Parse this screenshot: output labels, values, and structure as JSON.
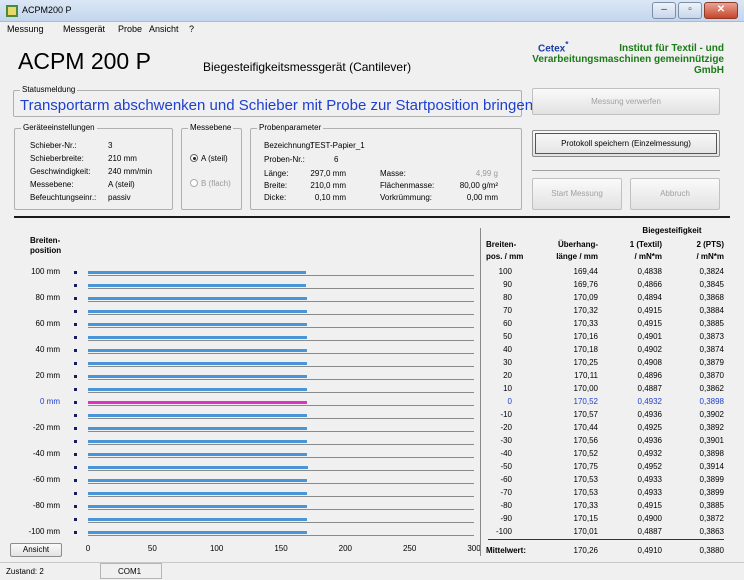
{
  "window": {
    "title": "ACPM200 P",
    "buttons": [
      "–",
      "▫",
      "✕"
    ]
  },
  "menu": [
    "Messung",
    "Messgerät",
    "Probe",
    "Ansicht",
    "?"
  ],
  "header": {
    "title": "ACPM 200 P",
    "subtitle": "Biegesteifigkeitsmessgerät  (Cantilever)",
    "brand": "Cetex",
    "brand_mark": "*",
    "institute": [
      "Institut für Textil - und",
      "Verarbeitungsmaschinen gemeinnützige",
      "GmbH"
    ]
  },
  "status": {
    "label": "Statusmeldung",
    "message": "Transportarm abschwenken und Schieber mit Probe zur Startposition bringen!"
  },
  "device": {
    "label": "Geräteeinstellungen",
    "rows": [
      {
        "k": "Schieber-Nr.:",
        "v": "3"
      },
      {
        "k": "Schieberbreite:",
        "v": "210 mm"
      },
      {
        "k": "Geschwindigkeit:",
        "v": "240 mm/min"
      },
      {
        "k": "Messebene:",
        "v": "A (steil)"
      },
      {
        "k": "Befeuchtungseinr.:",
        "v": "passiv"
      }
    ]
  },
  "plane": {
    "label": "Messebene",
    "a": "A (steil)",
    "b": "B (flach)"
  },
  "sample": {
    "label": "Probenparameter",
    "name_key": "Bezeichnung:",
    "name_val": "TEST-Papier_1",
    "nr_key": "Proben-Nr.:",
    "nr_val": "6",
    "left": [
      {
        "k": "Länge:",
        "v": "297,0 mm"
      },
      {
        "k": "Breite:",
        "v": "210,0 mm"
      },
      {
        "k": "Dicke:",
        "v": "0,10 mm"
      }
    ],
    "right": [
      {
        "k": "Masse:",
        "v": "4,99 g",
        "grey": true
      },
      {
        "k": "Flächenmasse:",
        "v": "80,00 g/m²",
        "grey": false
      },
      {
        "k": "Vorkrümmung:",
        "v": "0,00 mm",
        "grey": false
      }
    ]
  },
  "buttons": {
    "discard": "Messung verwerfen",
    "save": "Protokoll speichern (Einzelmessung)",
    "start": "Start Messung",
    "abort": "Abbruch",
    "view": "Ansicht"
  },
  "chart_data": {
    "type": "bar",
    "ylabel": "Breiten-\nposition",
    "categories": [
      "100 mm",
      "",
      "80 mm",
      "",
      "60 mm",
      "",
      "40 mm",
      "",
      "20 mm",
      "",
      "0 mm",
      "",
      "-20 mm",
      "",
      "-40 mm",
      "",
      "-60 mm",
      "",
      "-80 mm",
      "",
      "-100 mm"
    ],
    "values": [
      169.44,
      169.76,
      170.09,
      170.32,
      170.33,
      170.16,
      170.18,
      170.25,
      170.11,
      170.0,
      170.52,
      170.57,
      170.44,
      170.56,
      170.52,
      170.75,
      170.53,
      170.53,
      170.33,
      170.15,
      170.01
    ],
    "xticks": [
      "0",
      "50",
      "100",
      "150",
      "200",
      "250",
      "300"
    ],
    "xlim": [
      0,
      300
    ],
    "selected_index": 10,
    "colors": {
      "bar": "#4a94d8",
      "selected": "#e030c8"
    }
  },
  "table": {
    "super_header": "Biegesteifigkeit",
    "headers": [
      [
        "Breiten-",
        "pos. / mm"
      ],
      [
        "Überhang-",
        "länge / mm"
      ],
      [
        "1 (Textil)",
        "/ mN*m"
      ],
      [
        "2 (PTS)",
        "/ mN*m"
      ]
    ],
    "rows": [
      [
        "100",
        "169,44",
        "0,4838",
        "0,3824"
      ],
      [
        "90",
        "169,76",
        "0,4866",
        "0,3845"
      ],
      [
        "80",
        "170,09",
        "0,4894",
        "0,3868"
      ],
      [
        "70",
        "170,32",
        "0,4915",
        "0,3884"
      ],
      [
        "60",
        "170,33",
        "0,4915",
        "0,3885"
      ],
      [
        "50",
        "170,16",
        "0,4901",
        "0,3873"
      ],
      [
        "40",
        "170,18",
        "0,4902",
        "0,3874"
      ],
      [
        "30",
        "170,25",
        "0,4908",
        "0,3879"
      ],
      [
        "20",
        "170,11",
        "0,4896",
        "0,3870"
      ],
      [
        "10",
        "170,00",
        "0,4887",
        "0,3862"
      ],
      [
        "0",
        "170,52",
        "0,4932",
        "0,3898"
      ],
      [
        "-10",
        "170,57",
        "0,4936",
        "0,3902"
      ],
      [
        "-20",
        "170,44",
        "0,4925",
        "0,3892"
      ],
      [
        "-30",
        "170,56",
        "0,4936",
        "0,3901"
      ],
      [
        "-40",
        "170,52",
        "0,4932",
        "0,3898"
      ],
      [
        "-50",
        "170,75",
        "0,4952",
        "0,3914"
      ],
      [
        "-60",
        "170,53",
        "0,4933",
        "0,3899"
      ],
      [
        "-70",
        "170,53",
        "0,4933",
        "0,3899"
      ],
      [
        "-80",
        "170,33",
        "0,4915",
        "0,3885"
      ],
      [
        "-90",
        "170,15",
        "0,4900",
        "0,3872"
      ],
      [
        "-100",
        "170,01",
        "0,4887",
        "0,3863"
      ]
    ],
    "mean_label": "Mittelwert:",
    "mean": [
      "170,26",
      "0,4910",
      "0,3880"
    ]
  },
  "statusbar": {
    "state": "Zustand:  2",
    "port": "COM1"
  }
}
